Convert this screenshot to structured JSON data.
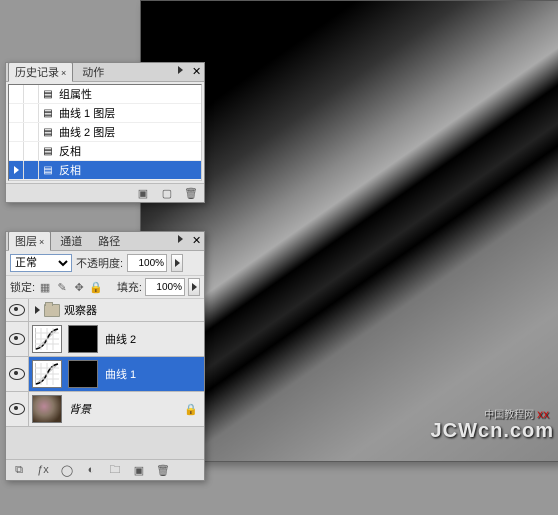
{
  "watermark": {
    "main": "JCWcn.com",
    "sub": "中国教程网",
    "accent": "XX"
  },
  "history_panel": {
    "tabs": [
      {
        "label": "历史记录",
        "active": true
      },
      {
        "label": "动作",
        "active": false
      }
    ],
    "items": [
      {
        "icon": "page",
        "label": "组属性",
        "selected": false,
        "marker": false
      },
      {
        "icon": "page",
        "label": "曲线 1 图层",
        "selected": false,
        "marker": false
      },
      {
        "icon": "page",
        "label": "曲线 2 图层",
        "selected": false,
        "marker": false
      },
      {
        "icon": "page",
        "label": "反相",
        "selected": false,
        "marker": false
      },
      {
        "icon": "page",
        "label": "反相",
        "selected": true,
        "marker": true
      }
    ]
  },
  "layers_panel": {
    "tabs": [
      {
        "label": "图层",
        "active": true
      },
      {
        "label": "通道",
        "active": false
      },
      {
        "label": "路径",
        "active": false
      }
    ],
    "blend_mode": "正常",
    "opacity_label": "不透明度:",
    "opacity_value": "100%",
    "lock_label": "锁定:",
    "fill_label": "填充:",
    "fill_value": "100%",
    "layers": [
      {
        "type": "group",
        "visible": true,
        "label": "观察器",
        "selected": false
      },
      {
        "type": "adjust",
        "visible": true,
        "label": "曲线 2",
        "selected": false,
        "mask": true
      },
      {
        "type": "adjust",
        "visible": true,
        "label": "曲线 1",
        "selected": true,
        "mask": true
      },
      {
        "type": "image",
        "visible": true,
        "label": "背景",
        "selected": false,
        "locked": true,
        "italic": true
      }
    ]
  }
}
